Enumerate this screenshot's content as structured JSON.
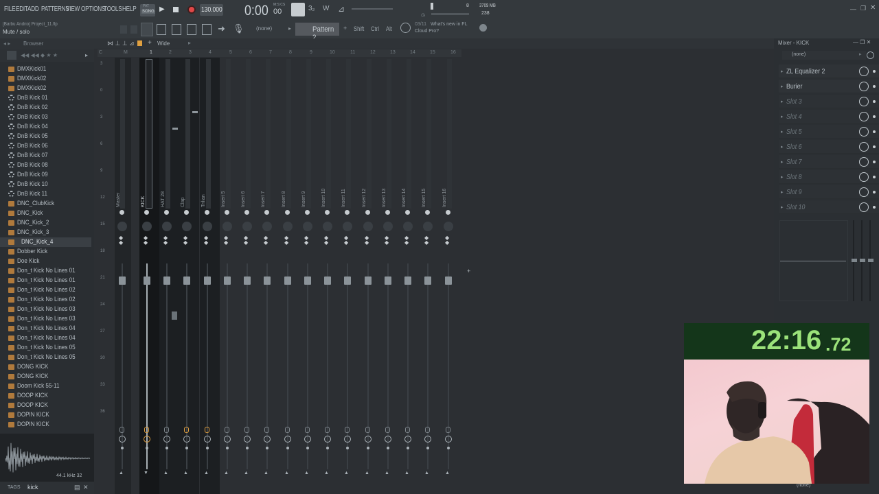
{
  "menu": [
    "FILE",
    "EDIT",
    "ADD",
    "PATTERNS",
    "VIEW",
    "OPTIONS",
    "TOOLS",
    "HELP"
  ],
  "transport": {
    "mode": "SONG",
    "mode_top": "PAT",
    "tempo": "130.000",
    "time": "0:00",
    "time_small": "00",
    "time_unit": "M:S:CS",
    "cpu": "8",
    "mem": "3709 MB",
    "voices": "238"
  },
  "hint": {
    "title": "[Barbu Andrio] Project_11.flp",
    "text": "Mute / solo"
  },
  "toolbar": {
    "none_label": "(none)",
    "pattern": "Pattern 2",
    "shift": "Shift",
    "ctrl": "Ctrl",
    "alt": "Alt",
    "news_date": "03/11",
    "news_line1": "What's new in FL",
    "news_line2": "Cloud Pro?"
  },
  "browser": {
    "title": "Browser",
    "items": [
      {
        "label": "DMXKick01",
        "t": "file"
      },
      {
        "label": "DMXKick02",
        "t": "file"
      },
      {
        "label": "DMXKick02",
        "t": "file"
      },
      {
        "label": "DnB Kick 01",
        "t": "gear"
      },
      {
        "label": "DnB Kick 02",
        "t": "gear"
      },
      {
        "label": "DnB Kick 03",
        "t": "gear"
      },
      {
        "label": "DnB Kick 04",
        "t": "gear"
      },
      {
        "label": "DnB Kick 05",
        "t": "gear"
      },
      {
        "label": "DnB Kick 06",
        "t": "gear"
      },
      {
        "label": "DnB Kick 07",
        "t": "gear"
      },
      {
        "label": "DnB Kick 08",
        "t": "gear"
      },
      {
        "label": "DnB Kick 09",
        "t": "gear"
      },
      {
        "label": "DnB Kick 10",
        "t": "gear"
      },
      {
        "label": "DnB Kick 11",
        "t": "gear"
      },
      {
        "label": "DNC_ClubKick",
        "t": "file"
      },
      {
        "label": "DNC_Kick",
        "t": "file"
      },
      {
        "label": "DNC_Kick_2",
        "t": "file"
      },
      {
        "label": "DNC_Kick_3",
        "t": "file"
      },
      {
        "label": "DNC_Kick_4",
        "t": "file",
        "sel": true
      },
      {
        "label": "Dobber Kick",
        "t": "file"
      },
      {
        "label": "Doe Kick",
        "t": "file"
      },
      {
        "label": "Don_t Kick No Lines 01",
        "t": "file"
      },
      {
        "label": "Don_t Kick No Lines 01",
        "t": "file"
      },
      {
        "label": "Don_t Kick No Lines 02",
        "t": "file"
      },
      {
        "label": "Don_t Kick No Lines 02",
        "t": "file"
      },
      {
        "label": "Don_t Kick No Lines 03",
        "t": "file"
      },
      {
        "label": "Don_t Kick No Lines 03",
        "t": "file"
      },
      {
        "label": "Don_t Kick No Lines 04",
        "t": "file"
      },
      {
        "label": "Don_t Kick No Lines 04",
        "t": "file"
      },
      {
        "label": "Don_t Kick No Lines 05",
        "t": "file"
      },
      {
        "label": "Don_t Kick No Lines 05",
        "t": "file"
      },
      {
        "label": "DONG KICK",
        "t": "file"
      },
      {
        "label": "DONG KICK",
        "t": "file"
      },
      {
        "label": "Doom Kick 55-11",
        "t": "file"
      },
      {
        "label": "DOOP KICK",
        "t": "file"
      },
      {
        "label": "DOOP KICK",
        "t": "file"
      },
      {
        "label": "DOPIN KICK",
        "t": "file"
      },
      {
        "label": "DOPIN KICK",
        "t": "file"
      }
    ],
    "sample_info": "44.1 kHz 32",
    "tags_label": "TAGS",
    "tags_value": "kick"
  },
  "mixer": {
    "view": "Wide",
    "track_labels": [
      "Master",
      "KICK",
      "HAT 28",
      "Clap",
      "Trilian",
      "Insert 5",
      "Insert 6",
      "Insert 7",
      "Insert 8",
      "Insert 9",
      "Insert 10",
      "Insert 11",
      "Insert 12",
      "Insert 13",
      "Insert 14",
      "Insert 15",
      "Insert 16"
    ],
    "ruler": [
      "C",
      "M",
      "1",
      "2",
      "3",
      "4",
      "5",
      "6",
      "7",
      "8",
      "9",
      "10",
      "11",
      "12",
      "13",
      "14",
      "15",
      "16"
    ],
    "db_scale": [
      "3",
      "0",
      "3",
      "6",
      "9",
      "12",
      "15",
      "18",
      "21",
      "24",
      "27",
      "30",
      "33",
      "36"
    ]
  },
  "mixer_panel": {
    "title": "Mixer - KICK",
    "input": "(none)",
    "output": "(none)",
    "slots": [
      {
        "label": "ZL Equalizer 2",
        "active": true
      },
      {
        "label": "Burier",
        "active": true
      },
      {
        "label": "Slot 3"
      },
      {
        "label": "Slot 4"
      },
      {
        "label": "Slot 5"
      },
      {
        "label": "Slot 6"
      },
      {
        "label": "Slot 7"
      },
      {
        "label": "Slot 8"
      },
      {
        "label": "Slot 9"
      },
      {
        "label": "Slot 10"
      }
    ]
  },
  "overlay": {
    "timer_main": "22:16",
    "timer_ms": ".72"
  },
  "colors": {
    "accent_orange": "#e0a040",
    "timer_green": "#9be27a",
    "record_red": "#e04848",
    "selected_strip": "#151719"
  }
}
